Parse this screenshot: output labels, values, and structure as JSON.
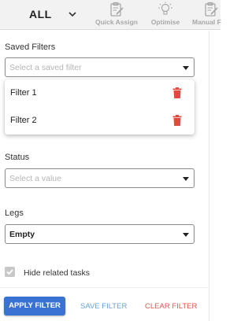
{
  "header": {
    "view_label": "ALL",
    "tools": [
      {
        "label": "Quick Assign",
        "icon": "clipboard-pencil-icon"
      },
      {
        "label": "Optimise",
        "icon": "lightbulb-icon"
      },
      {
        "label": "Manual F",
        "icon": "clipboard-pencil-icon"
      }
    ]
  },
  "filters": {
    "saved_filters": {
      "label": "Saved Filters",
      "placeholder": "Select a saved filter",
      "options": [
        {
          "name": "Filter 1",
          "delete_icon": "trash-icon"
        },
        {
          "name": "Filter 2",
          "delete_icon": "trash-icon"
        }
      ]
    },
    "status": {
      "label": "Status",
      "placeholder": "Select a value"
    },
    "legs": {
      "label": "Legs",
      "value": "Empty"
    },
    "hide_related": {
      "label": "Hide related tasks",
      "checked": true
    }
  },
  "actions": {
    "apply": "APPLY FILTER",
    "save": "SAVE FILTER",
    "clear": "CLEAR FILTER"
  },
  "colors": {
    "primary": "#3a72d4",
    "link": "#6aa2e0",
    "danger": "#e85450",
    "trash": "#e04a3f"
  }
}
